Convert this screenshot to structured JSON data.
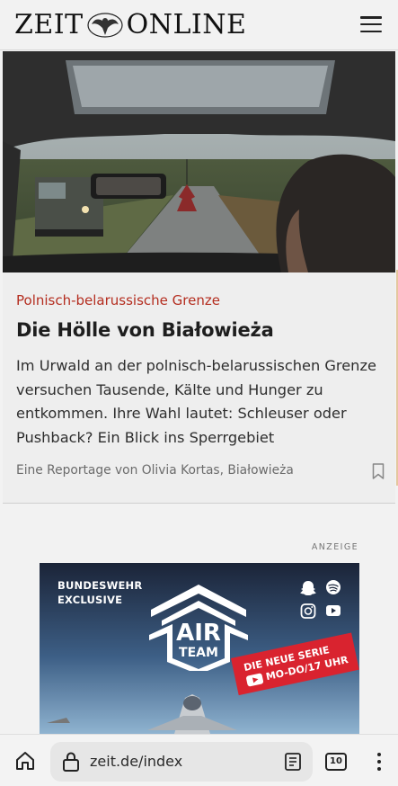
{
  "header": {
    "logo_left": "ZEIT",
    "logo_right": "ONLINE",
    "menu_icon": "hamburger-menu-icon"
  },
  "article": {
    "kicker": "Polnisch-belarussische Grenze",
    "headline": "Die Hölle von Białowieża",
    "teaser": "Im Urwald an der polnisch-belarussischen Grenze versuchen Tausende, Kälte und Hunger zu entkommen. Ihre Wahl lautet: Schleuser oder Pushback? Ein Blick ins Sperrgebiet",
    "author": "Eine Reportage von Olivia Kortas, Białowieża",
    "bookmark_icon": "bookmark-icon"
  },
  "ad": {
    "label": "ANZEIGE",
    "brand_line1": "BUNDESWEHR",
    "brand_line2": "EXCLUSIVE",
    "emblem_top": "AIR",
    "emblem_bottom": "TEAM",
    "ribbon_line1": "DIE NEUE SERIE",
    "ribbon_line2": "MO-DO/17 UHR",
    "social_icons": [
      "snapchat-icon",
      "spotify-icon",
      "instagram-icon",
      "youtube-icon"
    ]
  },
  "browser": {
    "url": "zeit.de/index",
    "tab_count": "10",
    "icons": [
      "home-icon",
      "lock-icon",
      "reader-mode-icon",
      "tabs-icon",
      "more-menu-icon"
    ]
  },
  "colors": {
    "kicker_red": "#b42d1f",
    "ad_red": "#d9232f"
  }
}
